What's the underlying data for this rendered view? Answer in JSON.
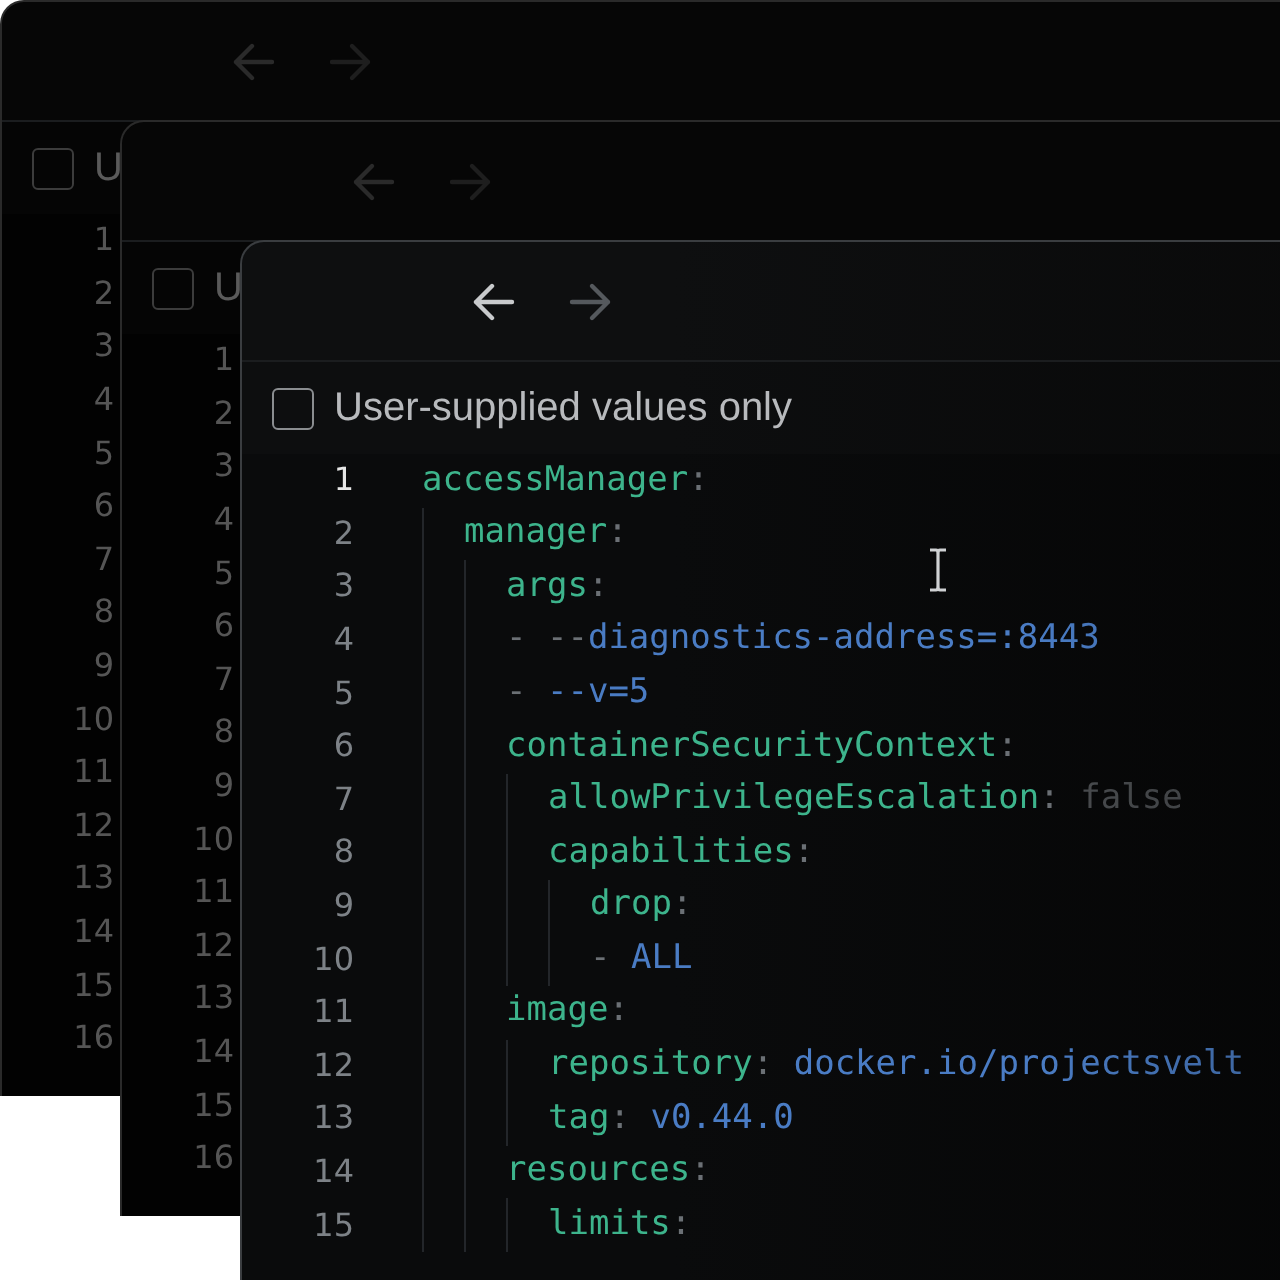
{
  "windows": [
    {
      "focused": false,
      "nav_buttons": [
        {
          "kind": "back",
          "disabled": false
        },
        {
          "kind": "forward",
          "disabled": true
        }
      ],
      "filter": {
        "label": "U",
        "checked": false
      },
      "line_numbers": [
        "1",
        "2",
        "3",
        "4",
        "5",
        "6",
        "7",
        "8",
        "9",
        "10",
        "11",
        "12",
        "13",
        "14",
        "15",
        "16"
      ]
    },
    {
      "focused": false,
      "nav_buttons": [
        {
          "kind": "back",
          "disabled": false
        },
        {
          "kind": "forward",
          "disabled": true
        }
      ],
      "filter": {
        "label": "U",
        "checked": false
      },
      "line_numbers": [
        "1",
        "2",
        "3",
        "4",
        "5",
        "6",
        "7",
        "8",
        "9",
        "10",
        "11",
        "12",
        "13",
        "14",
        "15",
        "16"
      ]
    },
    {
      "focused": true,
      "nav_buttons": [
        {
          "kind": "back",
          "disabled": false
        },
        {
          "kind": "forward",
          "disabled": true
        }
      ],
      "filter": {
        "label": "User-supplied values only",
        "checked": false
      },
      "code_lines": [
        {
          "number": "1",
          "active": true,
          "tokens": [
            {
              "kind": "key",
              "text": "accessManager"
            },
            {
              "kind": "punct",
              "text": ":"
            }
          ],
          "children": [
            {
              "number": "2",
              "active": false,
              "tokens": [
                {
                  "kind": "key",
                  "text": "manager"
                },
                {
                  "kind": "punct",
                  "text": ":"
                }
              ],
              "children": [
                {
                  "number": "3",
                  "active": false,
                  "tokens": [
                    {
                      "kind": "key",
                      "text": "args"
                    },
                    {
                      "kind": "punct",
                      "text": ":"
                    }
                  ]
                },
                {
                  "number": "4",
                  "active": false,
                  "tokens": [
                    {
                      "kind": "dash",
                      "text": "- --"
                    },
                    {
                      "kind": "value",
                      "text": "diagnostics-address=:8443"
                    }
                  ]
                },
                {
                  "number": "5",
                  "active": false,
                  "tokens": [
                    {
                      "kind": "dash",
                      "text": "- "
                    },
                    {
                      "kind": "value",
                      "text": "--v=5"
                    }
                  ]
                },
                {
                  "number": "6",
                  "active": false,
                  "tokens": [
                    {
                      "kind": "key",
                      "text": "containerSecurityContext"
                    },
                    {
                      "kind": "punct",
                      "text": ":"
                    }
                  ],
                  "children": [
                    {
                      "number": "7",
                      "active": false,
                      "tokens": [
                        {
                          "kind": "key",
                          "text": "allowPrivilegeEscalation"
                        },
                        {
                          "kind": "punct",
                          "text": ": "
                        },
                        {
                          "kind": "literal",
                          "text": "false"
                        }
                      ]
                    },
                    {
                      "number": "8",
                      "active": false,
                      "tokens": [
                        {
                          "kind": "key",
                          "text": "capabilities"
                        },
                        {
                          "kind": "punct",
                          "text": ":"
                        }
                      ],
                      "children": [
                        {
                          "number": "9",
                          "active": false,
                          "tokens": [
                            {
                              "kind": "key",
                              "text": "drop"
                            },
                            {
                              "kind": "punct",
                              "text": ":"
                            }
                          ]
                        },
                        {
                          "number": "10",
                          "active": false,
                          "tokens": [
                            {
                              "kind": "dash",
                              "text": "- "
                            },
                            {
                              "kind": "value",
                              "text": "ALL"
                            }
                          ]
                        }
                      ]
                    }
                  ]
                },
                {
                  "number": "11",
                  "active": false,
                  "tokens": [
                    {
                      "kind": "key",
                      "text": "image"
                    },
                    {
                      "kind": "punct",
                      "text": ":"
                    }
                  ],
                  "children": [
                    {
                      "number": "12",
                      "active": false,
                      "tokens": [
                        {
                          "kind": "key",
                          "text": "repository"
                        },
                        {
                          "kind": "punct",
                          "text": ": "
                        },
                        {
                          "kind": "value",
                          "text": "docker.io/projectsvelt"
                        }
                      ]
                    },
                    {
                      "number": "13",
                      "active": false,
                      "tokens": [
                        {
                          "kind": "key",
                          "text": "tag"
                        },
                        {
                          "kind": "punct",
                          "text": ": "
                        },
                        {
                          "kind": "value",
                          "text": "v0.44.0"
                        }
                      ]
                    }
                  ]
                },
                {
                  "number": "14",
                  "active": false,
                  "tokens": [
                    {
                      "kind": "key",
                      "text": "resources"
                    },
                    {
                      "kind": "punct",
                      "text": ":"
                    }
                  ],
                  "children": [
                    {
                      "number": "15",
                      "active": false,
                      "tokens": [
                        {
                          "kind": "key",
                          "text": "limits"
                        },
                        {
                          "kind": "punct",
                          "text": ":"
                        }
                      ]
                    }
                  ]
                }
              ]
            }
          ]
        }
      ]
    }
  ]
}
